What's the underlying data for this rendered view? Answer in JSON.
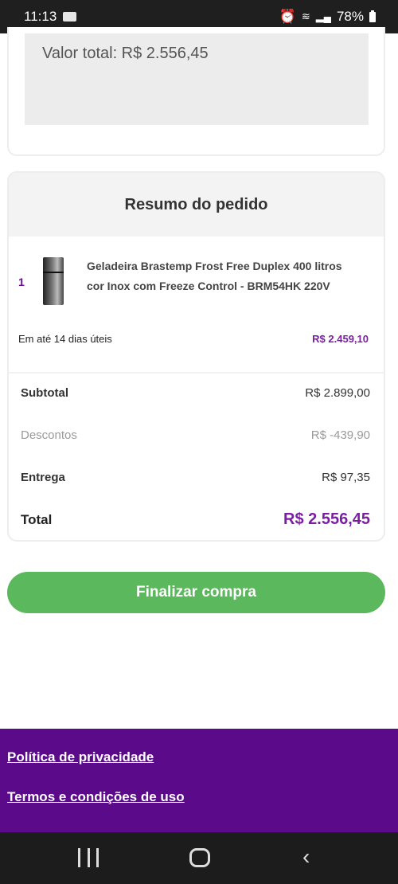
{
  "status_bar": {
    "time": "11:13",
    "battery": "78%",
    "icons": [
      "sim-card-icon",
      "alarm-icon",
      "wifi-icon",
      "signal-icon",
      "battery-icon"
    ]
  },
  "order_total": {
    "label": "Valor total: R$ 2.556,45"
  },
  "summary": {
    "title": "Resumo do pedido",
    "product": {
      "quantity": "1",
      "name": "Geladeira Brastemp Frost Free Duplex 400 litros cor Inox com Freeze Control - BRM54HK 220V",
      "delivery_time": "Em até 14 dias úteis",
      "price": "R$ 2.459,10"
    },
    "subtotal": {
      "label": "Subtotal",
      "value": "R$ 2.899,00"
    },
    "discounts": {
      "label": "Descontos",
      "value": "R$ -439,90"
    },
    "shipping": {
      "label": "Entrega",
      "value": "R$ 97,35"
    },
    "total": {
      "label": "Total",
      "value": "R$ 2.556,45"
    }
  },
  "checkout_button": {
    "label": "Finalizar compra"
  },
  "footer": {
    "links": [
      "Política de privacidade",
      "Termos e condições de uso"
    ]
  },
  "colors": {
    "accent_purple": "#7b1fa2",
    "footer_purple": "#5b0a8a",
    "checkout_green": "#5cb85c"
  }
}
